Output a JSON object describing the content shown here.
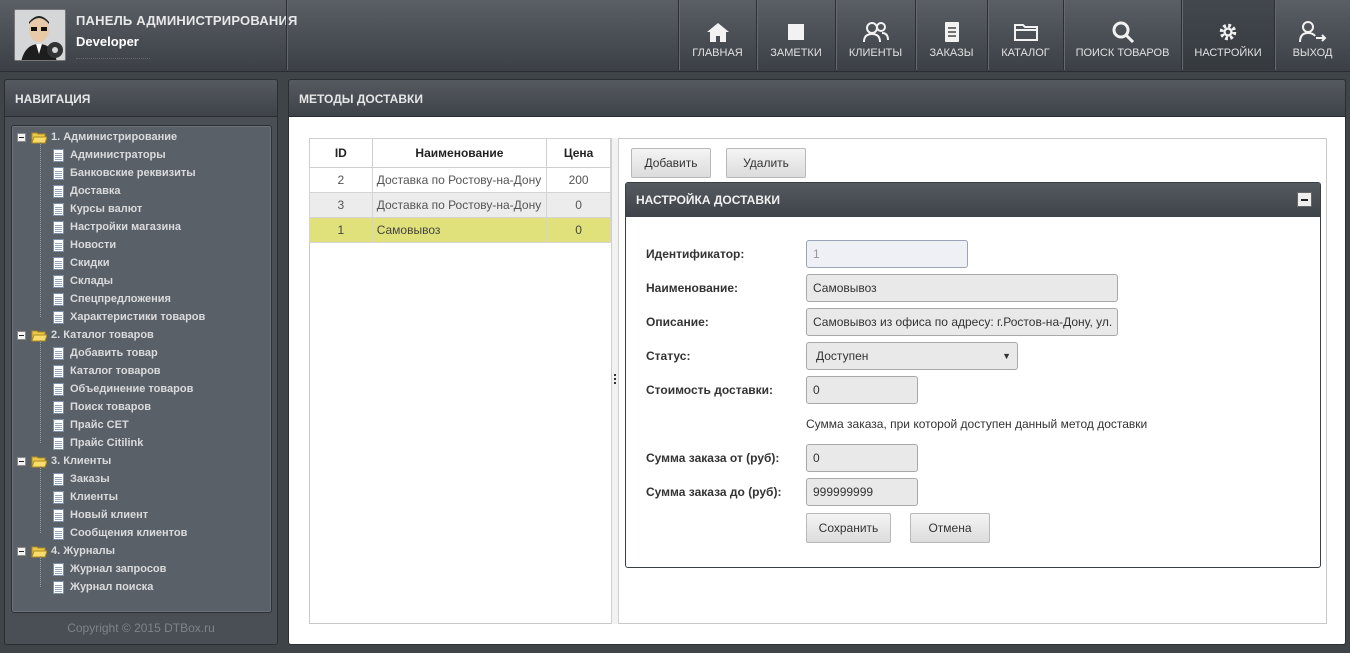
{
  "header": {
    "title": "ПАНЕЛЬ АДМИНИСТРИРОВАНИЯ",
    "user": "Developer",
    "menu": [
      {
        "label": "ГЛАВНАЯ",
        "icon": "home-icon"
      },
      {
        "label": "ЗАМЕТКИ",
        "icon": "note-icon"
      },
      {
        "label": "КЛИЕНТЫ",
        "icon": "users-icon"
      },
      {
        "label": "ЗАКАЗЫ",
        "icon": "document-icon"
      },
      {
        "label": "КАТАЛОГ",
        "icon": "folder-icon"
      },
      {
        "label": "ПОИСК ТОВАРОВ",
        "icon": "search-icon"
      },
      {
        "label": "НАСТРОЙКИ",
        "icon": "gear-icon",
        "active": true
      },
      {
        "label": "ВЫХОД",
        "icon": "logout-icon"
      }
    ]
  },
  "nav": {
    "title": "НАВИГАЦИЯ",
    "groups": [
      {
        "label": "1. Администрирование",
        "items": [
          "Администраторы",
          "Банковские реквизиты",
          "Доставка",
          "Курсы валют",
          "Настройки магазина",
          "Новости",
          "Скидки",
          "Склады",
          "Спецпредложения",
          "Характеристики товаров"
        ]
      },
      {
        "label": "2. Каталог товаров",
        "items": [
          "Добавить товар",
          "Каталог товаров",
          "Объединение товаров",
          "Поиск товаров",
          "Прайс СЕТ",
          "Прайс Citilink"
        ]
      },
      {
        "label": "3. Клиенты",
        "items": [
          "Заказы",
          "Клиенты",
          "Новый клиент",
          "Сообщения клиентов"
        ]
      },
      {
        "label": "4. Журналы",
        "items": [
          "Журнал запросов",
          "Журнал поиска"
        ]
      }
    ],
    "copyright": "Copyright © 2015 DTBox.ru"
  },
  "main": {
    "title": "МЕТОДЫ ДОСТАВКИ",
    "table": {
      "columns": [
        "ID",
        "Наименование",
        "Цена"
      ],
      "rows": [
        {
          "id": "2",
          "name": "Доставка по Ростову-на-Дону",
          "price": "200"
        },
        {
          "id": "3",
          "name": "Доставка по Ростову-на-Дону",
          "price": "0"
        },
        {
          "id": "1",
          "name": "Самовывоз",
          "price": "0",
          "selected": true
        }
      ]
    },
    "buttons": {
      "add": "Добавить",
      "delete": "Удалить"
    },
    "form": {
      "title": "НАСТРОЙКА ДОСТАВКИ",
      "id_label": "Идентификатор:",
      "id_value": "1",
      "name_label": "Наименование:",
      "name_value": "Самовывоз",
      "desc_label": "Описание:",
      "desc_value": "Самовывоз из офиса по адресу: г.Ростов-на-Дону, ул.",
      "status_label": "Статус:",
      "status_value": "Доступен",
      "cost_label": "Стоимость доставки:",
      "cost_value": "0",
      "hint": "Сумма заказа, при которой доступен данный метод доставки",
      "from_label": "Сумма заказа от (руб):",
      "from_value": "0",
      "to_label": "Сумма заказа до (руб):",
      "to_value": "999999999",
      "save": "Сохранить",
      "cancel": "Отмена"
    }
  }
}
